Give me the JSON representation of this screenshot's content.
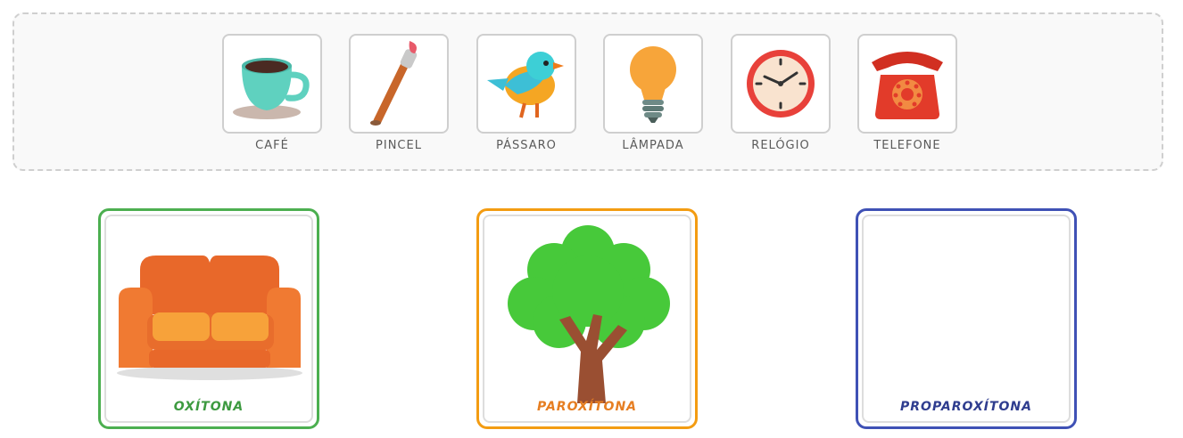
{
  "bank": {
    "items": [
      {
        "label": "CAFÉ",
        "icon": "coffee-cup-icon"
      },
      {
        "label": "PINCEL",
        "icon": "paintbrush-icon"
      },
      {
        "label": "PÁSSARO",
        "icon": "bird-icon"
      },
      {
        "label": "LÂMPADA",
        "icon": "lightbulb-icon"
      },
      {
        "label": "RELÓGIO",
        "icon": "clock-icon"
      },
      {
        "label": "TELEFONE",
        "icon": "telephone-icon"
      }
    ]
  },
  "zones": [
    {
      "label": "OXÍTONA",
      "color": "#4caf50",
      "placed_icon": "sofa-icon"
    },
    {
      "label": "PAROXÍTONA",
      "color": "#f39c12",
      "placed_icon": "tree-icon"
    },
    {
      "label": "PROPAROXÍTONA",
      "color": "#3f51b5",
      "placed_icon": ""
    }
  ]
}
